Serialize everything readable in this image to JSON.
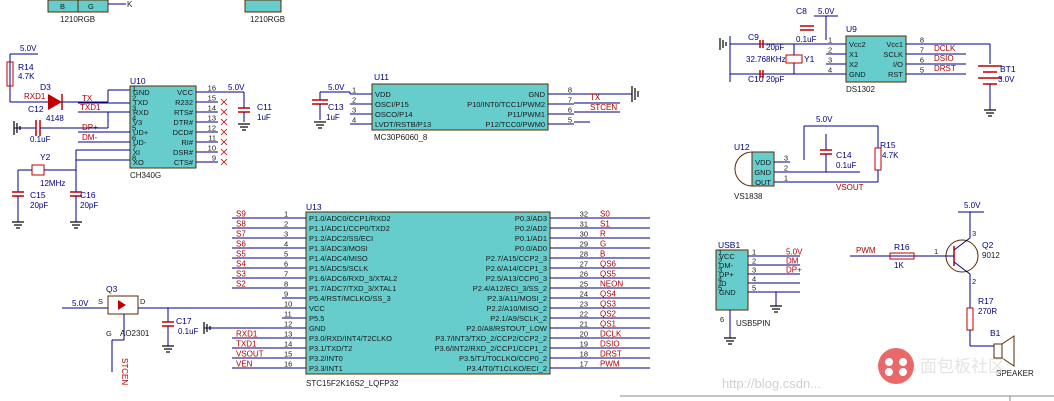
{
  "top_partial": {
    "label_left": "1210RGB",
    "label_right": "1210RGB",
    "pins": [
      "B",
      "G"
    ],
    "k": "K"
  },
  "u10": {
    "ref": "U10",
    "part": "CH340G",
    "left_pins": [
      "GND",
      "TXD",
      "RXD",
      "V3",
      "UD+",
      "UD-",
      "XI",
      "XO"
    ],
    "right_pins": [
      "VCC",
      "R232",
      "RTS#",
      "DTR#",
      "DCD#",
      "RI#",
      "DSR#",
      "CTS#"
    ],
    "right_nums": [
      "16",
      "15",
      "14",
      "13",
      "12",
      "11",
      "10",
      "9"
    ],
    "left_nums": [
      "1",
      "2",
      "3",
      "4",
      "5",
      "6",
      "7",
      "8"
    ],
    "vcc": "5.0V"
  },
  "r14": {
    "ref": "R14",
    "value": "4.7K",
    "vcc": "5.0V"
  },
  "d3": {
    "ref": "D3",
    "value": "4148",
    "net": "RXD1"
  },
  "c12": {
    "ref": "C12",
    "value": "0.1uF"
  },
  "c11": {
    "ref": "C11",
    "value": "1uF"
  },
  "y2": {
    "ref": "Y2",
    "value": "12MHz"
  },
  "c15": {
    "ref": "C15",
    "value": "20pF"
  },
  "c16": {
    "ref": "C16",
    "value": "20pF"
  },
  "u10_nets": {
    "tx": "TX",
    "txd1": "TXD1",
    "dp": "DP+",
    "dm": "DM-"
  },
  "u11": {
    "ref": "U11",
    "part": "MC30P6060_8",
    "vcc": "5.0V",
    "left_pins": [
      "VDD",
      "OSCI/P15",
      "OSCO/P14",
      "LVDT/RSTB/P13"
    ],
    "left_nums": [
      "1",
      "2",
      "3",
      "4"
    ],
    "right_pins": [
      "GND",
      "P10/INT0/TCC1/PWM2",
      "P11/PWM1",
      "P12/TCC0/PWM0"
    ],
    "right_nums": [
      "8",
      "7",
      "6",
      "5"
    ],
    "nets": [
      "TX",
      "STCEN"
    ],
    "cap": {
      "ref": "C13",
      "value": "1uF"
    }
  },
  "u9": {
    "ref": "U9",
    "part": "DS1302",
    "vcc": "5.0V",
    "left_pins": [
      "Vcc2",
      "X1",
      "X2",
      "GND"
    ],
    "left_nums": [
      "1",
      "2",
      "3",
      "4"
    ],
    "right_pins": [
      "Vcc1",
      "SCLK",
      "I/O",
      "RST"
    ],
    "right_nums": [
      "8",
      "7",
      "6",
      "5"
    ],
    "nets": [
      "DCLK",
      "DSIO",
      "DRST"
    ],
    "c8": {
      "ref": "C8",
      "value": "0.1uF"
    },
    "c9": {
      "ref": "C9",
      "value": "20pF"
    },
    "c10": {
      "ref": "C10",
      "value": "20pF"
    },
    "y1": {
      "ref": "Y1",
      "value": "32.768KHz"
    },
    "bt1": {
      "ref": "BT1",
      "value": "3.0V"
    }
  },
  "u12": {
    "ref": "U12",
    "part": "VS1838",
    "vcc": "5.0V",
    "pins": [
      "VDD",
      "GND",
      "OUT"
    ],
    "nums": [
      "3",
      "2",
      "1"
    ],
    "c14": {
      "ref": "C14",
      "value": "0.1uF"
    },
    "r15": {
      "ref": "R15",
      "value": "4.7K"
    },
    "net": "VSOUT"
  },
  "u13": {
    "ref": "U13",
    "part": "STC15F2K16S2_LQFP32",
    "left_nets": [
      "S9",
      "S8",
      "S7",
      "S6",
      "S5",
      "S4",
      "S3",
      "S2",
      "",
      "",
      "",
      "",
      "RXD1",
      "TXD1",
      "VSOUT",
      "VEN"
    ],
    "left_pins": [
      "P1.0/ADC0/CCP1/RXD2",
      "P1.1/ADC1/CCP0/TXD2",
      "P1.2/ADC2/SS/ECI",
      "P1.3/ADC3/MOSI",
      "P1.4/ADC4/MISO",
      "P1.5/ADC5/SCLK",
      "P1.6/ADC6/RXD_3/XTAL2",
      "P1.7/ADC7/TXD_3/XTAL1",
      "P5.4/RST/MCLKO/SS_3",
      "VCC",
      "P5.5",
      "GND",
      "P3.0/RXD/INT4/T2CLKO",
      "P3.1/TXD/T2",
      "P3.2/INT0",
      "P3.3/INT1"
    ],
    "left_nums": [
      "1",
      "2",
      "3",
      "4",
      "5",
      "6",
      "7",
      "8",
      "9",
      "10",
      "11",
      "12",
      "13",
      "14",
      "15",
      "16"
    ],
    "right_pins": [
      "P0.3/AD3",
      "P0.2/AD2",
      "P0.1/AD1",
      "P0.0/AD0",
      "P2.7/A15/CCP2_3",
      "P2.6/A14/CCP1_3",
      "P2.5/A13/CCP0_3",
      "P2.4/A12/ECI_3/SS_2",
      "P2.3/A11/MOSI_2",
      "P2.2/A10/MISO_2",
      "P2.1/A9/SCLK_2",
      "P2.0/A8/RSTOUT_LOW",
      "P3.7/INT3/TXD_2/CCP2/CCP2_2",
      "P3.6/INT2/RXD_2/CCP1/CCP1_2",
      "P3.5/T1/T0CLKO/CCP0_2",
      "P3.4/T0/T1CLKO/ECI_2"
    ],
    "right_nums": [
      "32",
      "31",
      "30",
      "29",
      "28",
      "27",
      "26",
      "25",
      "24",
      "23",
      "22",
      "21",
      "20",
      "19",
      "18",
      "17"
    ],
    "right_nets": [
      "S0",
      "S1",
      "R",
      "G",
      "B",
      "QS6",
      "QS5",
      "NEON",
      "QS4",
      "QS3",
      "QS2",
      "QS1",
      "DCLK",
      "DSIO",
      "DRST",
      "PWM"
    ]
  },
  "q3": {
    "ref": "Q3",
    "part": "AO2301",
    "vcc": "5.0V",
    "pins": [
      "S",
      "D",
      "G"
    ],
    "net": "STCEN"
  },
  "c17": {
    "ref": "C17",
    "value": "0.1uF"
  },
  "usb1": {
    "ref": "USB1",
    "part": "USB5PIN",
    "pins": [
      "VCC",
      "DM-",
      "DP+",
      "ID",
      "GND"
    ],
    "nums": [
      "1",
      "2",
      "3",
      "4",
      "5"
    ],
    "nets": [
      "5.0V",
      "DM",
      "DP+"
    ],
    "extra_num": "6"
  },
  "q2": {
    "ref": "Q2",
    "part": "9012",
    "vcc": "5.0V",
    "nums": [
      "1",
      "2",
      "3"
    ]
  },
  "r16": {
    "ref": "R16",
    "value": "1K",
    "net": "PWM"
  },
  "r17": {
    "ref": "R17",
    "value": "270R"
  },
  "b1": {
    "ref": "B1",
    "part": "SPEAKER"
  },
  "watermark": {
    "brand": "面包板社区",
    "url": "http://blog.csdn..."
  }
}
